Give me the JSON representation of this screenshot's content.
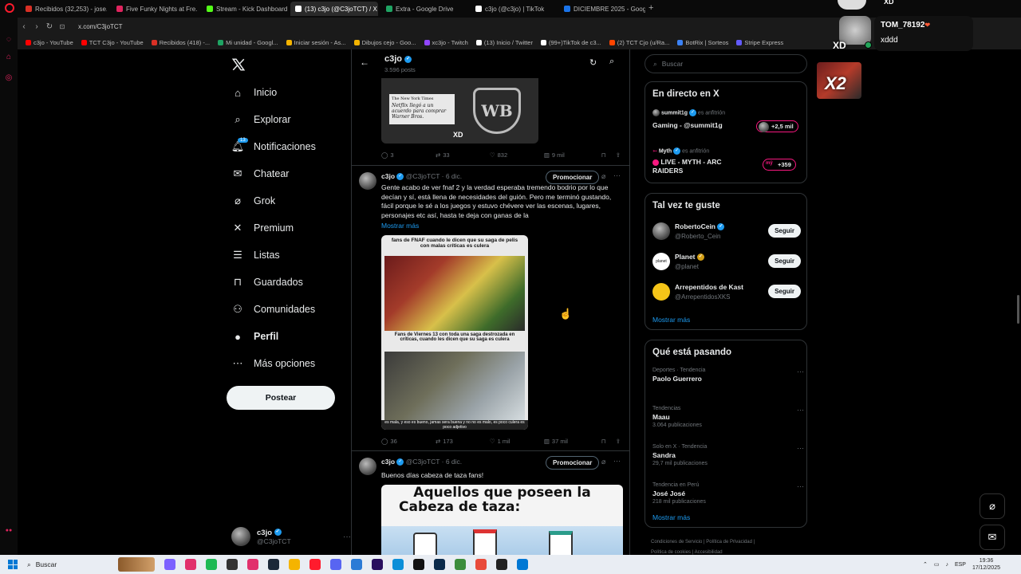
{
  "browser": {
    "tabs": [
      {
        "label": "Recibidos (32,253) - jose...",
        "color": "#d93025",
        "icon": "gmail-icon"
      },
      {
        "label": "Five Funky Nights at Fre...",
        "color": "#e0245e",
        "icon": "youtube-icon"
      },
      {
        "label": "Stream - Kick Dashboard",
        "color": "#53fc18",
        "icon": "kick-icon"
      },
      {
        "label": "(13) c3jo (@C3joTCT) / X",
        "color": "#ffffff",
        "icon": "x-icon"
      },
      {
        "label": "Extra - Google Drive",
        "color": "#1fa463",
        "icon": "drive-icon"
      },
      {
        "label": "c3jo (@c3jo) | TikTok",
        "color": "#ffffff",
        "icon": "tiktok-icon"
      },
      {
        "label": "DICIEMBRE 2025 - Googl...",
        "color": "#1a73e8",
        "icon": "calendar-icon"
      }
    ],
    "url": "x.com/C3joTCT",
    "bookmarks": [
      {
        "label": "c3jo - YouTube",
        "color": "#ff0000"
      },
      {
        "label": "TCT C3jo - YouTube",
        "color": "#ff0000"
      },
      {
        "label": "Recibidos (418) -...",
        "color": "#d93025"
      },
      {
        "label": "Mi unidad - Googl...",
        "color": "#1fa463"
      },
      {
        "label": "Iniciar sesión - As...",
        "color": "#f5b400"
      },
      {
        "label": "Dibujos cejo - Goo...",
        "color": "#f5b400"
      },
      {
        "label": "xc3jo - Twitch",
        "color": "#9146ff"
      },
      {
        "label": "(13) Inicio / Twitter",
        "color": "#ffffff"
      },
      {
        "label": "(99+)TikTok de c3...",
        "color": "#ffffff"
      },
      {
        "label": "(2) TCT Cjo (u/Ra...",
        "color": "#ff4500"
      },
      {
        "label": "BotRix | Sorteos",
        "color": "#3b82f6"
      },
      {
        "label": "Stripe Express",
        "color": "#635bff"
      }
    ]
  },
  "nav": {
    "items": [
      {
        "label": "Inicio",
        "icon": "home-icon"
      },
      {
        "label": "Explorar",
        "icon": "search-icon"
      },
      {
        "label": "Notificaciones",
        "icon": "bell-icon",
        "badge": "13"
      },
      {
        "label": "Chatear",
        "icon": "mail-icon"
      },
      {
        "label": "Grok",
        "icon": "grok-icon"
      },
      {
        "label": "Premium",
        "icon": "x-icon"
      },
      {
        "label": "Listas",
        "icon": "list-icon"
      },
      {
        "label": "Guardados",
        "icon": "bookmark-icon"
      },
      {
        "label": "Comunidades",
        "icon": "people-icon"
      },
      {
        "label": "Perfil",
        "icon": "person-icon"
      },
      {
        "label": "Más opciones",
        "icon": "more-icon"
      }
    ],
    "post_label": "Postear",
    "account": {
      "name": "c3jo",
      "handle": "@C3joTCT"
    }
  },
  "profile_header": {
    "name": "c3jo",
    "posts": "3.596 posts"
  },
  "tweets": [
    {
      "media": {
        "headline": "Netflix llegó a un acuerdo para comprar Warner Bros.",
        "paper": "The New York Times",
        "logo": "WB",
        "caption": "XD"
      },
      "stats": {
        "replies": "3",
        "reposts": "33",
        "likes": "832",
        "views": "9 mil"
      }
    },
    {
      "author": "c3jo",
      "handle": "@C3joTCT",
      "time": "6 dic.",
      "promo": "Promocionar",
      "text": "Gente acabo de ver fnaf 2 y la verdad esperaba tremendo bodrio por lo que decían y sí, está llena de necesidades del guión. Pero me terminó gustando, fácil porque le sé a los juegos y estuvo chévere ver las escenas, lugares, personajes etc así, hasta te deja con ganas de la",
      "more": "Mostrar más",
      "meme": {
        "top": "fans de FNAF cuando le dicen que su saga de pelis con malas críticas es culera",
        "mid": "Fans de Viernes 13 con toda una saga destrozada en críticas, cuando les dicen que su saga es culera",
        "bottom": "es mala, y eso es bueno, jamas sera buena y no no es malo, es poco culera es poco adjetivo"
      },
      "stats": {
        "replies": "36",
        "reposts": "173",
        "likes": "1 mil",
        "views": "37 mil"
      }
    },
    {
      "author": "c3jo",
      "handle": "@C3joTCT",
      "time": "6 dic.",
      "promo": "Promocionar",
      "text": "Buenos días cabeza de taza fans!",
      "meme": {
        "line1": "Aquellos que poseen la",
        "line2": "Cabeza de taza:"
      }
    }
  ],
  "right": {
    "search_placeholder": "Buscar",
    "live": {
      "title": "En directo en X",
      "items": [
        {
          "host": "summit1g",
          "host_role": "es anfitrión",
          "title": "Gaming - @summit1g",
          "count": "+2,5 mil",
          "badge_color": "#f91880"
        },
        {
          "host": "Myth",
          "host_role": "es anfitrión",
          "title": "LIVE - MYTH - ARC RAIDERS",
          "count": "+359",
          "badge_color": "#f91880"
        }
      ]
    },
    "who_to_follow": {
      "title": "Tal vez te guste",
      "users": [
        {
          "name": "RobertoCein",
          "handle": "@Roberto_Cein",
          "badge": "blue"
        },
        {
          "name": "Planet",
          "handle": "@planet",
          "badge": "gold",
          "logo": "planet"
        },
        {
          "name": "Arrepentidos de Kast",
          "handle": "@ArrepentidosXKS",
          "badge": "none"
        }
      ],
      "follow_label": "Seguir",
      "more": "Mostrar más"
    },
    "trends": {
      "title": "Qué está pasando",
      "items": [
        {
          "context": "Deportes · Tendencia",
          "name": "Paolo Guerrero",
          "count": ""
        },
        {
          "context": "Tendencias",
          "name": "Maau",
          "count": "3.064 publicaciones"
        },
        {
          "context": "Solo en X · Tendencia",
          "name": "Sandra",
          "count": "29,7 mil publicaciones"
        },
        {
          "context": "Tendencia en Perú",
          "name": "José José",
          "count": "218 mil publicaciones"
        }
      ],
      "more": "Mostrar más"
    },
    "footer": [
      "Condiciones de Servicio",
      "Política de Privacidad",
      "Política de cookies",
      "Accesibilidad"
    ]
  },
  "overlay": {
    "user": "TOM_78192",
    "message": "xddd",
    "top_text": "XD",
    "mid_text": "XD",
    "multiplier": "X2"
  },
  "taskbar": {
    "search": "Buscar",
    "lang": "ESP",
    "time": "19:36",
    "date": "17/12/2025"
  }
}
